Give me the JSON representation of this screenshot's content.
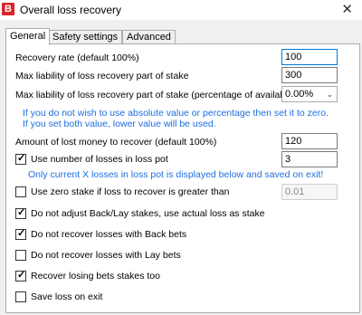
{
  "window": {
    "title": "Overall loss recovery",
    "app_icon_letter": "B",
    "close_glyph": "✕"
  },
  "tabs": [
    {
      "label": "General",
      "active": true
    },
    {
      "label": "Safety settings",
      "active": false
    },
    {
      "label": "Advanced",
      "active": false
    }
  ],
  "fields": {
    "recovery_rate": {
      "label": "Recovery rate (default 100%)",
      "value": "100"
    },
    "max_liability": {
      "label": "Max liability of loss recovery part of stake",
      "value": "300"
    },
    "max_liability_pct": {
      "label": "Max liability of loss recovery part of stake (percentage of available balance)",
      "selected": "0.00%"
    },
    "info_line1": "If you do not wish to use absolute value or percentage then set it to zero.",
    "info_line2": "If you set both value, lower value will be used.",
    "amount_lost": {
      "label": "Amount of lost money to recover (default 100%)",
      "value": "120"
    },
    "use_losses": {
      "label": "Use number of losses in loss pot",
      "checked": true,
      "value": "3"
    },
    "info_line3": "Only current X losses in loss pot is displayed below and saved on exit!",
    "zero_stake": {
      "label": "Use zero stake if loss to recover is greater than",
      "checked": false,
      "value": "0.01"
    }
  },
  "options": {
    "no_adjust": {
      "label": "Do not adjust Back/Lay stakes, use actual loss as stake",
      "checked": true
    },
    "no_back": {
      "label": "Do not recover losses with Back bets",
      "checked": true
    },
    "no_lay": {
      "label": "Do not recover losses with Lay bets",
      "checked": false
    },
    "recover_losing": {
      "label": "Recover losing bets stakes too",
      "checked": true
    },
    "save_loss": {
      "label": "Save loss on exit",
      "checked": false
    }
  },
  "colors": {
    "info_text": "#1e6fe0",
    "app_icon": "#d8262c"
  }
}
